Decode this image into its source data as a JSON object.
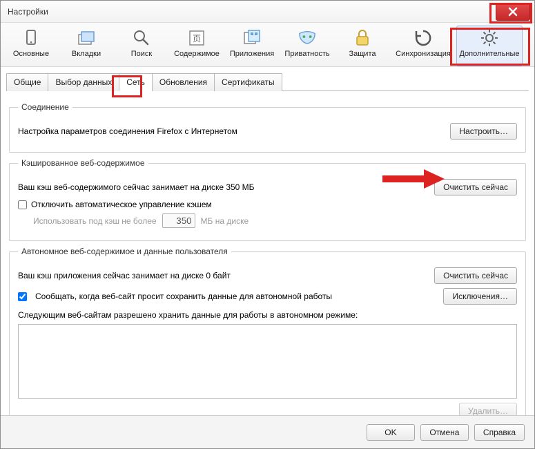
{
  "window": {
    "title": "Настройки"
  },
  "toolbar": {
    "items": [
      {
        "label": "Основные",
        "icon": "device"
      },
      {
        "label": "Вкладки",
        "icon": "tabs"
      },
      {
        "label": "Поиск",
        "icon": "search"
      },
      {
        "label": "Содержимое",
        "icon": "content"
      },
      {
        "label": "Приложения",
        "icon": "apps"
      },
      {
        "label": "Приватность",
        "icon": "mask"
      },
      {
        "label": "Защита",
        "icon": "lock"
      },
      {
        "label": "Синхронизация",
        "icon": "sync"
      },
      {
        "label": "Дополнительные",
        "icon": "gear",
        "selected": true
      }
    ]
  },
  "tabs": {
    "items": [
      {
        "label": "Общие"
      },
      {
        "label": "Выбор данных"
      },
      {
        "label": "Сеть",
        "active": true
      },
      {
        "label": "Обновления"
      },
      {
        "label": "Сертификаты"
      }
    ]
  },
  "connection": {
    "legend": "Соединение",
    "text": "Настройка параметров соединения Firefox с Интернетом",
    "button": "Настроить…"
  },
  "cache": {
    "legend": "Кэшированное веб-содержимое",
    "usage": "Ваш кэш веб-содержимого сейчас занимает на диске 350 МБ",
    "clear": "Очистить сейчас",
    "override_label": "Отключить автоматическое управление кэшем",
    "limit_prefix": "Использовать под кэш не более",
    "limit_value": "350",
    "limit_suffix": "МБ на диске"
  },
  "offline": {
    "legend": "Автономное веб-содержимое и данные пользователя",
    "usage": "Ваш кэш приложения сейчас занимает на диске 0 байт",
    "clear": "Очистить сейчас",
    "notify_label": "Сообщать, когда веб-сайт просит сохранить данные для автономной работы",
    "exceptions": "Исключения…",
    "list_label": "Следующим веб-сайтам разрешено хранить данные для работы в автономном режиме:",
    "remove": "Удалить…"
  },
  "dialog_buttons": {
    "ok": "OK",
    "cancel": "Отмена",
    "help": "Справка"
  }
}
